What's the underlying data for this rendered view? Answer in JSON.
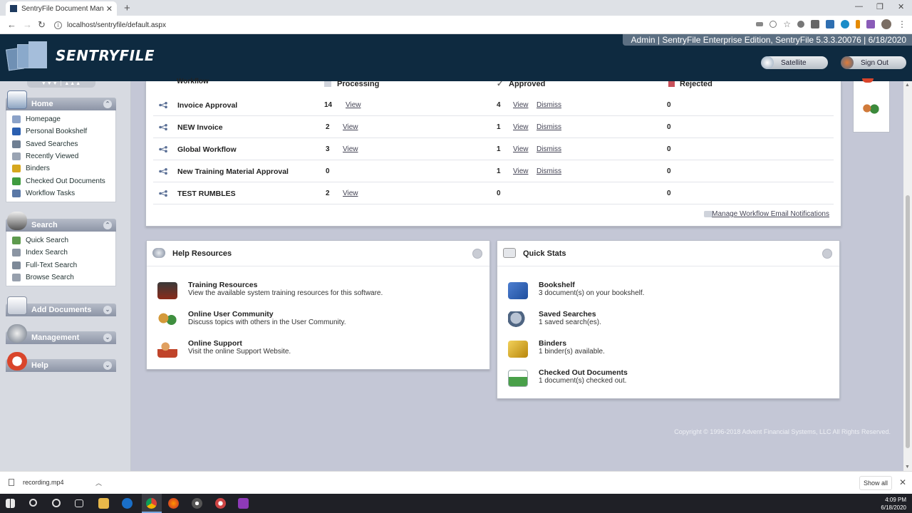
{
  "browser": {
    "tab_title": "SentryFile Document Manageme",
    "url": "localhost/sentryfile/default.aspx"
  },
  "header": {
    "brand": "SENTRYFILE",
    "info": "Admin | SentryFile Enterprise Edition, SentryFile 5.3.3.20076 | 6/18/2020",
    "satellite_label": "Satellite",
    "signout_label": "Sign Out"
  },
  "sidebar": {
    "home": {
      "title": "Home",
      "items": [
        "Homepage",
        "Personal Bookshelf",
        "Saved Searches",
        "Recently Viewed",
        "Binders",
        "Checked Out Documents",
        "Workflow Tasks"
      ]
    },
    "search": {
      "title": "Search",
      "items": [
        "Quick Search",
        "Index Search",
        "Full-Text Search",
        "Browse Search"
      ]
    },
    "add_documents": {
      "title": "Add Documents"
    },
    "management": {
      "title": "Management"
    },
    "help": {
      "title": "Help"
    }
  },
  "workflow": {
    "headers": {
      "workflow": "Workflow",
      "processing": "Processing",
      "approved": "Approved",
      "rejected": "Rejected"
    },
    "view_label": "View",
    "dismiss_label": "Dismiss",
    "rows": [
      {
        "name": "Invoice Approval",
        "processing": "14",
        "approved": "4",
        "rejected": "0"
      },
      {
        "name": "NEW Invoice",
        "processing": "2",
        "approved": "1",
        "rejected": "0"
      },
      {
        "name": "Global Workflow",
        "processing": "3",
        "approved": "1",
        "rejected": "0"
      },
      {
        "name": "New Training Material Approval",
        "processing": "0",
        "approved": "1",
        "rejected": "0"
      },
      {
        "name": "TEST RUMBLES",
        "processing": "2",
        "approved": "0",
        "rejected": "0"
      }
    ],
    "manage_link": "Manage Workflow Email Notifications"
  },
  "help_resources": {
    "title": "Help Resources",
    "items": [
      {
        "title": "Training Resources",
        "desc": "View the available system training resources for this software."
      },
      {
        "title": "Online User Community",
        "desc": "Discuss topics with others in the User Community."
      },
      {
        "title": "Online Support",
        "desc": "Visit the online Support Website."
      }
    ]
  },
  "quick_stats": {
    "title": "Quick Stats",
    "items": [
      {
        "title": "Bookshelf",
        "desc": "3 document(s) on your bookshelf."
      },
      {
        "title": "Saved Searches",
        "desc": "1 saved search(es)."
      },
      {
        "title": "Binders",
        "desc": "1 binder(s) available."
      },
      {
        "title": "Checked Out Documents",
        "desc": "1 document(s) checked out."
      }
    ]
  },
  "footer": {
    "copyright": "Copyright © 1996-2018 Advent Financial Systems, LLC All Rights Reserved."
  },
  "downloads": {
    "file": "recording.mp4",
    "show_all": "Show all"
  },
  "taskbar": {
    "time": "4:09 PM",
    "date": "6/18/2020"
  }
}
